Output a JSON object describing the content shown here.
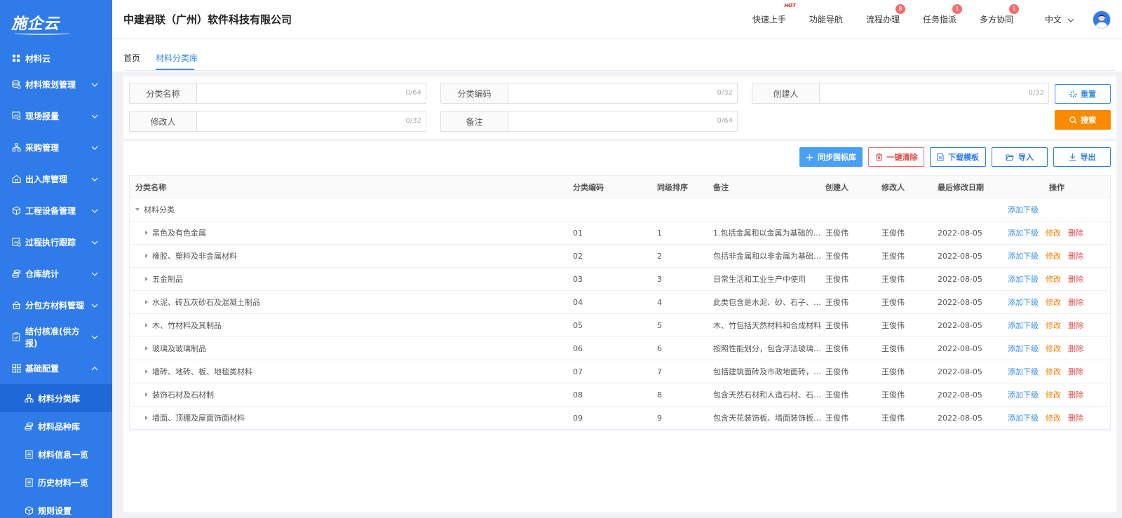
{
  "sidebar": {
    "logo_text": "施企云",
    "top_item": "材料云",
    "items": [
      {
        "label": "材料策划管理",
        "icon": "database-icon"
      },
      {
        "label": "现场报量",
        "icon": "chart-screen-icon"
      },
      {
        "label": "采购管理",
        "icon": "hierarchy-icon"
      },
      {
        "label": "出入库管理",
        "icon": "warehouse-icon"
      },
      {
        "label": "工程设备管理",
        "icon": "cube-icon"
      },
      {
        "label": "过程执行跟踪",
        "icon": "tracking-icon"
      },
      {
        "label": "仓库统计",
        "icon": "coins-icon"
      },
      {
        "label": "分包方材料管理",
        "icon": "subcontract-icon"
      },
      {
        "label": "结付核准(供方报)",
        "icon": "clipboard-check-icon"
      },
      {
        "label": "基础配置",
        "icon": "grid-icon"
      }
    ],
    "sub_items": [
      {
        "label": "材料分类库",
        "icon": "hierarchy-icon"
      },
      {
        "label": "材料品种库",
        "icon": "coins-icon"
      },
      {
        "label": "材料信息一览",
        "icon": "document-list-icon"
      },
      {
        "label": "历史材料一览",
        "icon": "document-list-icon"
      },
      {
        "label": "规则设置",
        "icon": "cube-icon"
      }
    ]
  },
  "header": {
    "company": "中建君联（广州）软件科技有限公司",
    "nav": [
      {
        "label": "快速上手",
        "badge": "HOT"
      },
      {
        "label": "功能导航",
        "badge": ""
      },
      {
        "label": "流程办理",
        "badge": "8"
      },
      {
        "label": "任务指派",
        "badge": "1"
      },
      {
        "label": "多方协同",
        "badge": "1"
      }
    ],
    "language": "中文"
  },
  "tabs": [
    {
      "label": "首页"
    },
    {
      "label": "材料分类库"
    }
  ],
  "search": {
    "fields": [
      {
        "label": "分类名称",
        "count": "0/64",
        "value": ""
      },
      {
        "label": "分类编码",
        "count": "0/32",
        "value": ""
      },
      {
        "label": "创建人",
        "count": "0/32",
        "value": ""
      },
      {
        "label": "修改人",
        "count": "0/32",
        "value": ""
      },
      {
        "label": "备注",
        "count": "0/64",
        "value": ""
      }
    ],
    "reset_label": "重置",
    "search_label": "搜索"
  },
  "toolbar": {
    "sync_label": "同步国标库",
    "clear_label": "一键清除",
    "download_label": "下载模板",
    "import_label": "导入",
    "export_label": "导出"
  },
  "table": {
    "headers": {
      "name": "分类名称",
      "code": "分类编码",
      "sort": "同级排序",
      "note": "备注",
      "creator": "创建人",
      "modifier": "修改人",
      "date": "最后修改日期",
      "ops": "操作"
    },
    "root": {
      "name": "材料分类",
      "add_label": "添加下级"
    },
    "ops": {
      "add": "添加下级",
      "edit": "修改",
      "delete": "删除"
    },
    "rows": [
      {
        "name": "黑色及有色金属",
        "code": "01",
        "sort": "1",
        "note": "1.包括金属和以金属为基础的…",
        "creator": "王俊伟",
        "modifier": "王俊伟",
        "date": "2022-08-05"
      },
      {
        "name": "橡胶、塑料及非金属材料",
        "code": "02",
        "sort": "2",
        "note": "包括非金属和以非金属为基础…",
        "creator": "王俊伟",
        "modifier": "王俊伟",
        "date": "2022-08-05"
      },
      {
        "name": "五金制品",
        "code": "03",
        "sort": "3",
        "note": "日常生活和工业生产中使用",
        "creator": "王俊伟",
        "modifier": "王俊伟",
        "date": "2022-08-05"
      },
      {
        "name": "水泥、砖瓦灰砂石及混凝土制品",
        "code": "04",
        "sort": "4",
        "note": "此类包含是水泥、砂、石子、…",
        "creator": "王俊伟",
        "modifier": "王俊伟",
        "date": "2022-08-05"
      },
      {
        "name": "木、竹材料及其制品",
        "code": "05",
        "sort": "5",
        "note": "木、竹包括天然材料和合成材料",
        "creator": "王俊伟",
        "modifier": "王俊伟",
        "date": "2022-08-05"
      },
      {
        "name": "玻璃及玻璃制品",
        "code": "06",
        "sort": "6",
        "note": "按照性能划分，包含浮法玻璃…",
        "creator": "王俊伟",
        "modifier": "王俊伟",
        "date": "2022-08-05"
      },
      {
        "name": "墙砖、地砖、板、地毯类材料",
        "code": "07",
        "sort": "7",
        "note": "包括建筑面砖及市政地面砖，…",
        "creator": "王俊伟",
        "modifier": "王俊伟",
        "date": "2022-08-05"
      },
      {
        "name": "装饰石材及石材制",
        "code": "08",
        "sort": "8",
        "note": "包含天然石材和人造石材、石…",
        "creator": "王俊伟",
        "modifier": "王俊伟",
        "date": "2022-08-05"
      },
      {
        "name": "墙面、顶棚及屋面饰面材料",
        "code": "09",
        "sort": "9",
        "note": "包含天花装饰板、墙面装饰板…",
        "creator": "王俊伟",
        "modifier": "王俊伟",
        "date": "2022-08-05"
      }
    ]
  }
}
